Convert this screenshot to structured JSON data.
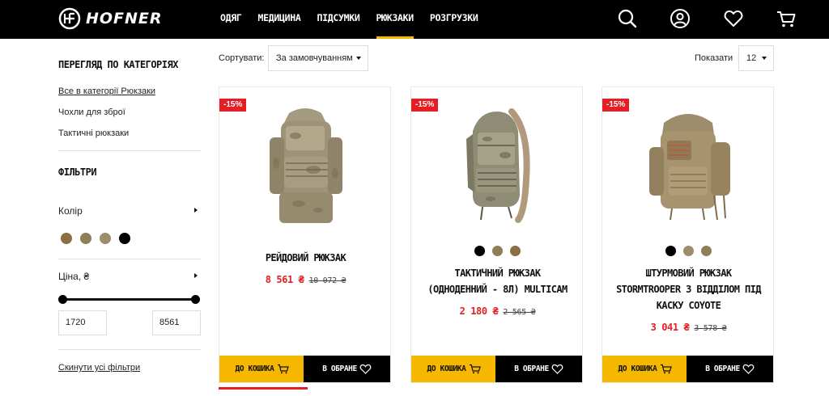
{
  "brand": {
    "name": "HOFNER"
  },
  "nav": [
    {
      "label": "ОДЯГ",
      "active": false
    },
    {
      "label": "МЕДИЦИНА",
      "active": false
    },
    {
      "label": "ПІДСУМКИ",
      "active": false
    },
    {
      "label": "РЮКЗАКИ",
      "active": true
    },
    {
      "label": "РОЗГРУЗКИ",
      "active": false
    }
  ],
  "header_icons": [
    "search-icon",
    "user-icon",
    "heart-icon",
    "cart-icon"
  ],
  "sidebar": {
    "categories_title": "ПЕРЕГЛЯД ПО КАТЕГОРІЯХ",
    "categories": [
      {
        "label": "Все в категорії Рюкзаки",
        "current": true
      },
      {
        "label": "Чохли для зброї",
        "current": false
      },
      {
        "label": "Тактичні рюкзаки",
        "current": false
      }
    ],
    "filters_title": "ФІЛЬТРИ",
    "color_label": "Колір",
    "colors": [
      "#8a6e44",
      "#8c7f5a",
      "#9c8e6a",
      "#000000"
    ],
    "price_label": "Ціна, ₴",
    "price_min": "1720",
    "price_max": "8561",
    "reset_label": "Скинути усі фільтри"
  },
  "toolbar": {
    "sort_label": "Сортувати:",
    "sort_value": "За замовчуванням",
    "show_label": "Показати",
    "show_value": "12"
  },
  "products": [
    {
      "badge": "-15%",
      "title_lines": [
        "РЕЙДОВИЙ РЮКЗАК"
      ],
      "price_new": "8 561 ₴",
      "price_old": "10 072 ₴",
      "swatches": [],
      "cart_label": "ДО КОШИКА",
      "fav_label": "В ОБРАНЕ"
    },
    {
      "badge": "-15%",
      "title_lines": [
        "ТАКТИЧНИЙ РЮКЗАК",
        "(ОДНОДЕННИЙ - 8Л) MULTICAM"
      ],
      "price_new": "2 180 ₴",
      "price_old": "2 565 ₴",
      "swatches": [
        "#000000",
        "#8c7f5a",
        "#8a6e44"
      ],
      "cart_label": "ДО КОШИКА",
      "fav_label": "В ОБРАНЕ"
    },
    {
      "badge": "-15%",
      "title_lines": [
        "ШТУРМОВИЙ РЮКЗАК",
        "STORMTROOPER З ВІДДІЛОМ ПІД",
        "КАСКУ COYOTE"
      ],
      "price_new": "3 041 ₴",
      "price_old": "3 578 ₴",
      "swatches": [
        "#000000",
        "#9c8e6a",
        "#8c7f5a"
      ],
      "cart_label": "ДО КОШИКА",
      "fav_label": "В ОБРАНЕ"
    }
  ],
  "colors": {
    "accent": "#f6b700",
    "sale": "#e51d25",
    "header_bg": "#000000"
  }
}
